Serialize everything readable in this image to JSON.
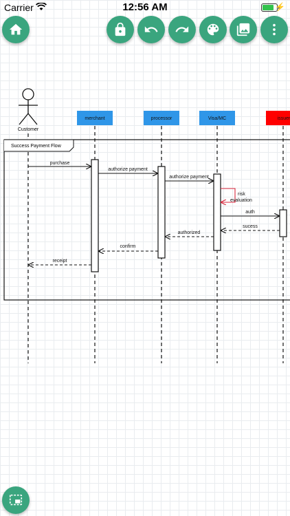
{
  "status_bar": {
    "carrier": "Carrier",
    "time": "12:56 AM",
    "battery_fraction": 0.9
  },
  "toolbar": {
    "home_icon": "home-icon",
    "lock_icon": "lock-icon",
    "undo_icon": "undo-icon",
    "redo_icon": "redo-icon",
    "theme_icon": "palette-icon",
    "gallery_icon": "gallery-icon",
    "more_icon": "more-vertical-icon",
    "selection_icon": "selection-icon"
  },
  "colors": {
    "accent": "#3aa57e",
    "participant_blue": "#2f96e8",
    "participant_red": "#ff0000",
    "self_message": "#d9263b"
  },
  "diagram": {
    "actor": "Customer",
    "participants": [
      "merchant",
      "processor",
      "Visa/MC",
      "issuer"
    ],
    "frame_label": "Success Payment Flow",
    "messages": {
      "purchase": "purchase",
      "authorize_payment_1": "authorize payment",
      "authorize_payment_2": "authorize payment",
      "risk_line1": "risk",
      "risk_line2": "evaluation",
      "auth": "auth",
      "sucess": "sucess",
      "authorized": "authorized",
      "confirm": "confirm",
      "receipt": "receipt"
    }
  }
}
